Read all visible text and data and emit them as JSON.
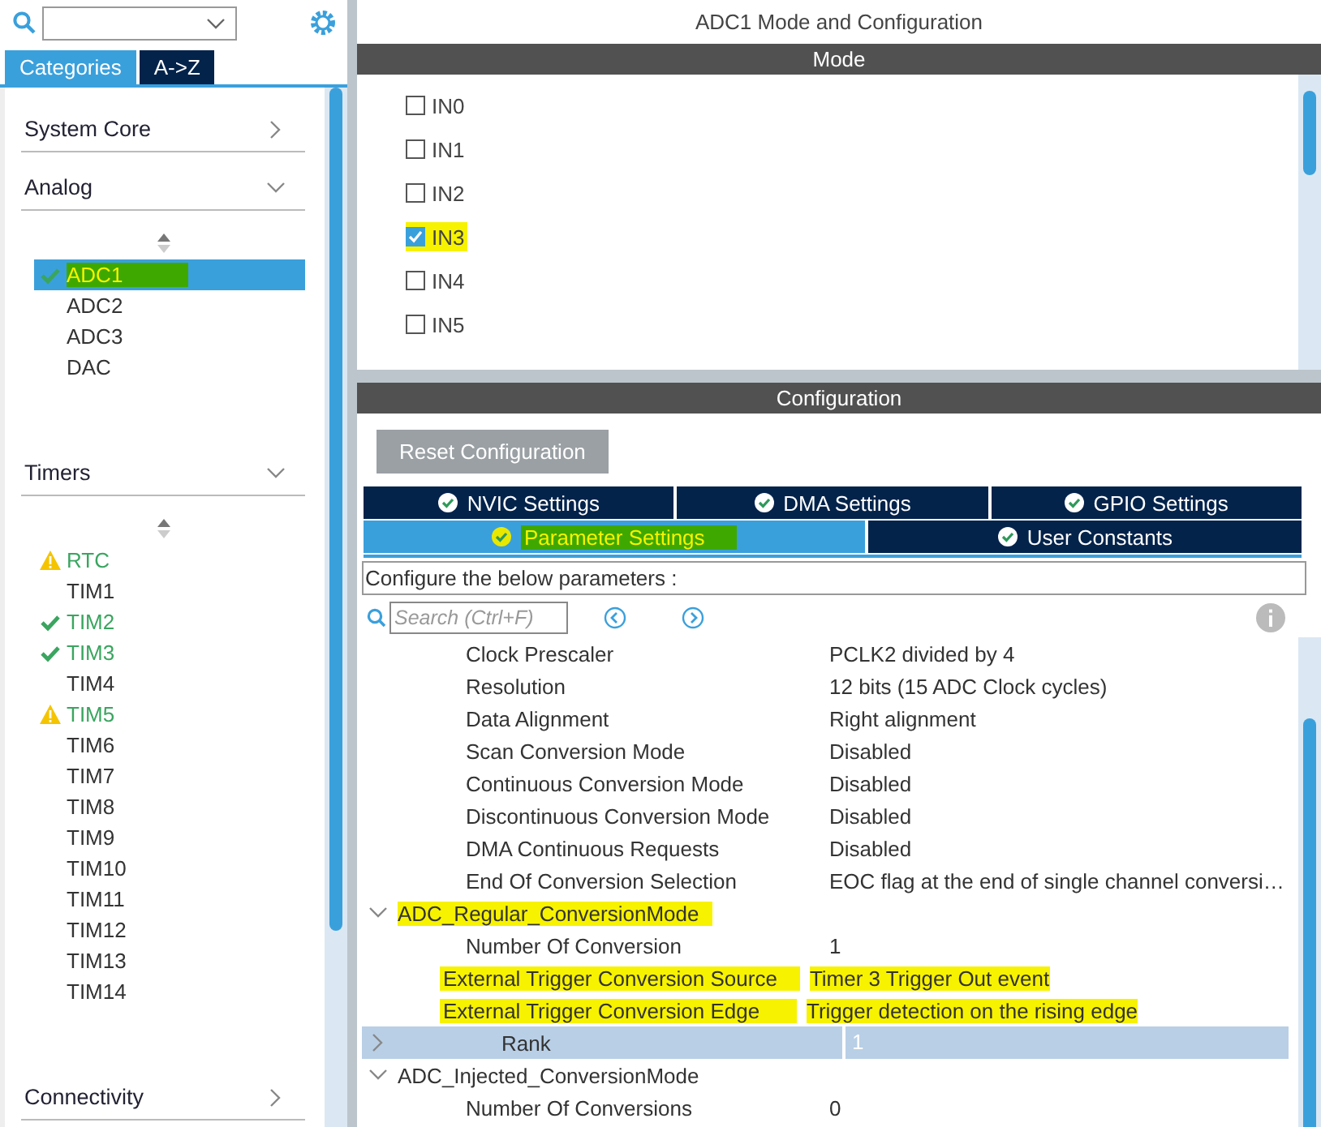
{
  "sidebar": {
    "tabs": [
      {
        "label": "Categories",
        "selected": true
      },
      {
        "label": "A->Z",
        "selected": false
      }
    ],
    "categories": [
      {
        "label": "System Core",
        "expanded": false
      },
      {
        "label": "Analog",
        "expanded": true,
        "items": [
          {
            "label": "ADC1",
            "kind": "ok",
            "selected": true,
            "highlighted": true
          },
          {
            "label": "ADC2",
            "kind": "plain",
            "selected": false,
            "highlighted": false
          },
          {
            "label": "ADC3",
            "kind": "plain",
            "selected": false,
            "highlighted": false
          },
          {
            "label": "DAC",
            "kind": "plain",
            "selected": false,
            "highlighted": false
          }
        ]
      },
      {
        "label": "Timers",
        "expanded": true,
        "items": [
          {
            "label": "RTC",
            "kind": "warning",
            "selected": false,
            "highlighted": false
          },
          {
            "label": "TIM1",
            "kind": "plain",
            "selected": false,
            "highlighted": false
          },
          {
            "label": "TIM2",
            "kind": "ok",
            "selected": false,
            "highlighted": false
          },
          {
            "label": "TIM3",
            "kind": "ok",
            "selected": false,
            "highlighted": false
          },
          {
            "label": "TIM4",
            "kind": "plain",
            "selected": false,
            "highlighted": false
          },
          {
            "label": "TIM5",
            "kind": "warning",
            "selected": false,
            "highlighted": false
          },
          {
            "label": "TIM6",
            "kind": "plain",
            "selected": false,
            "highlighted": false
          },
          {
            "label": "TIM7",
            "kind": "plain",
            "selected": false,
            "highlighted": false
          },
          {
            "label": "TIM8",
            "kind": "plain",
            "selected": false,
            "highlighted": false
          },
          {
            "label": "TIM9",
            "kind": "plain",
            "selected": false,
            "highlighted": false
          },
          {
            "label": "TIM10",
            "kind": "plain",
            "selected": false,
            "highlighted": false
          },
          {
            "label": "TIM11",
            "kind": "plain",
            "selected": false,
            "highlighted": false
          },
          {
            "label": "TIM12",
            "kind": "plain",
            "selected": false,
            "highlighted": false
          },
          {
            "label": "TIM13",
            "kind": "plain",
            "selected": false,
            "highlighted": false
          },
          {
            "label": "TIM14",
            "kind": "plain",
            "selected": false,
            "highlighted": false
          }
        ]
      },
      {
        "label": "Connectivity",
        "expanded": false
      }
    ]
  },
  "title": "ADC1 Mode and Configuration",
  "mode": {
    "header": "Mode",
    "channels": [
      {
        "label": "IN0",
        "checked": false,
        "highlighted": false
      },
      {
        "label": "IN1",
        "checked": false,
        "highlighted": false
      },
      {
        "label": "IN2",
        "checked": false,
        "highlighted": false
      },
      {
        "label": "IN3",
        "checked": true,
        "highlighted": true
      },
      {
        "label": "IN4",
        "checked": false,
        "highlighted": false
      },
      {
        "label": "IN5",
        "checked": false,
        "highlighted": false
      }
    ]
  },
  "configuration": {
    "header": "Configuration",
    "reset_button": "Reset Configuration",
    "tab_rows": [
      [
        {
          "label": "NVIC Settings",
          "selected": false,
          "highlighted": false
        },
        {
          "label": "DMA Settings",
          "selected": false,
          "highlighted": false
        },
        {
          "label": "GPIO Settings",
          "selected": false,
          "highlighted": false
        }
      ],
      [
        {
          "label": "Parameter Settings",
          "selected": true,
          "highlighted": true
        },
        {
          "label": "User Constants",
          "selected": false,
          "highlighted": false
        }
      ]
    ],
    "hint": "Configure the below parameters :",
    "search": {
      "placeholder": "Search (Ctrl+F)"
    },
    "parameters": [
      {
        "kind": "row",
        "name": "Clock Prescaler",
        "value": "PCLK2 divided by 4",
        "highlighted": false
      },
      {
        "kind": "row",
        "name": "Resolution",
        "value": "12 bits (15 ADC Clock cycles)",
        "highlighted": false
      },
      {
        "kind": "row",
        "name": "Data Alignment",
        "value": "Right alignment",
        "highlighted": false
      },
      {
        "kind": "row",
        "name": "Scan Conversion Mode",
        "value": "Disabled",
        "highlighted": false
      },
      {
        "kind": "row",
        "name": "Continuous Conversion Mode",
        "value": "Disabled",
        "highlighted": false
      },
      {
        "kind": "row",
        "name": "Discontinuous Conversion Mode",
        "value": "Disabled",
        "highlighted": false
      },
      {
        "kind": "row",
        "name": "DMA Continuous Requests",
        "value": "Disabled",
        "highlighted": false
      },
      {
        "kind": "row",
        "name": "End Of Conversion Selection",
        "value": "EOC flag at the end of single channel conversi…",
        "highlighted": false
      },
      {
        "kind": "group",
        "name": "ADC_Regular_ConversionMode",
        "expanded": true,
        "highlighted": true,
        "children": [
          {
            "kind": "row",
            "name": "Number Of Conversion",
            "value": "1",
            "highlighted": false
          },
          {
            "kind": "row",
            "name": "External Trigger Conversion Source",
            "value": "Timer 3 Trigger Out event",
            "highlighted": true
          },
          {
            "kind": "row",
            "name": "External Trigger Conversion Edge",
            "value": "Trigger detection on the rising edge",
            "highlighted": true
          },
          {
            "kind": "group",
            "name": "Rank",
            "value": "1",
            "expanded": false,
            "selected": true,
            "highlighted": false
          }
        ]
      },
      {
        "kind": "group",
        "name": "ADC_Injected_ConversionMode",
        "expanded": true,
        "highlighted": false,
        "children": [
          {
            "kind": "row",
            "name": "Number Of Conversions",
            "value": "0",
            "highlighted": false
          }
        ]
      }
    ]
  }
}
